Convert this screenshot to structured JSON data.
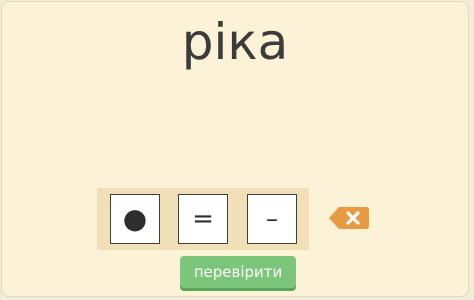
{
  "word": "ріка",
  "tiles": [
    {
      "symbol": "●",
      "icon": "dot-icon"
    },
    {
      "symbol": "=",
      "icon": "equals-icon"
    },
    {
      "symbol": "–",
      "icon": "dash-icon"
    }
  ],
  "delete_icon": "backspace-icon",
  "check_button": {
    "label": "перевірити"
  },
  "colors": {
    "background": "#fcf2d7",
    "tray": "#f0dfb7",
    "delete": "#e79a3f",
    "check_button": "#7bc67a"
  }
}
